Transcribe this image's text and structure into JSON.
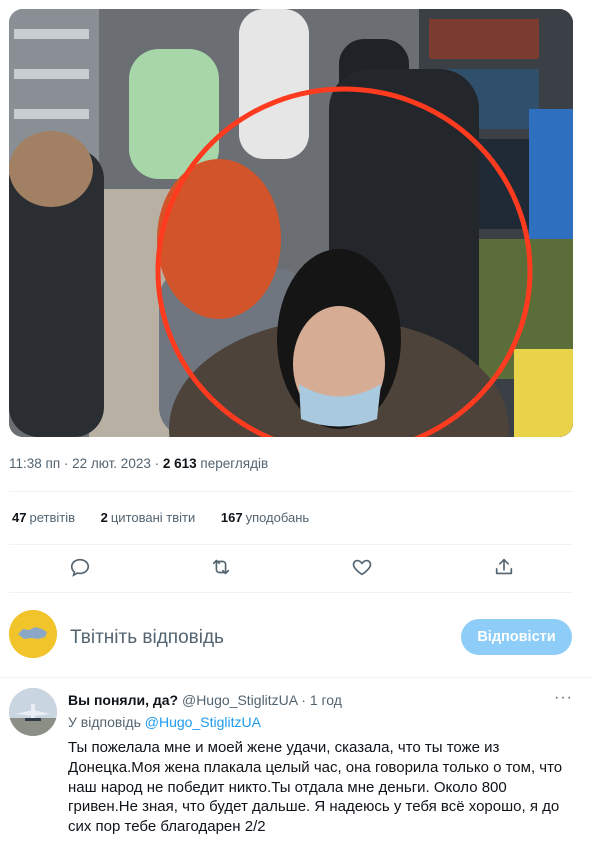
{
  "tweet_meta": {
    "time": "11:38 пп · 22 лют. 2023 ·",
    "views_count": "2 613",
    "views_label": "переглядів"
  },
  "stats": {
    "retweets_count": "47",
    "retweets_label": "ретвітів",
    "quotes_count": "2",
    "quotes_label": "цитовані твіти",
    "likes_count": "167",
    "likes_label": "уподобань"
  },
  "actions": {
    "reply_icon": "reply-icon",
    "retweet_icon": "retweet-icon",
    "like_icon": "heart-icon",
    "share_icon": "share-icon"
  },
  "reply_box": {
    "prompt": "Твітніть відповідь",
    "button_label": "Відповісти"
  },
  "reply_tweet": {
    "name": "Вы поняли, да?",
    "handle": "@Hugo_StiglitzUA",
    "separator": "·",
    "time": "1 год",
    "more": "···",
    "replying_prefix": "У відповідь",
    "replying_handle": "@Hugo_StiglitzUA",
    "text": "Ты пожелала мне и моей жене удачи, сказала, что ты тоже из Донецка.Моя жена плакала целый час, она говорила только о том, что наш народ не победит никто.Ты отдала мне деньги. Около 800 гривен.Не зная, что будет дальше. Я надеюсь у тебя всё хорошо, я до сих пор тебе благодарен 2/2"
  },
  "colors": {
    "accent": "#1d9bf0",
    "reply_button": "#8ecdf7",
    "secondary_text": "#536471",
    "highlight_circle": "#ff3b1f"
  }
}
